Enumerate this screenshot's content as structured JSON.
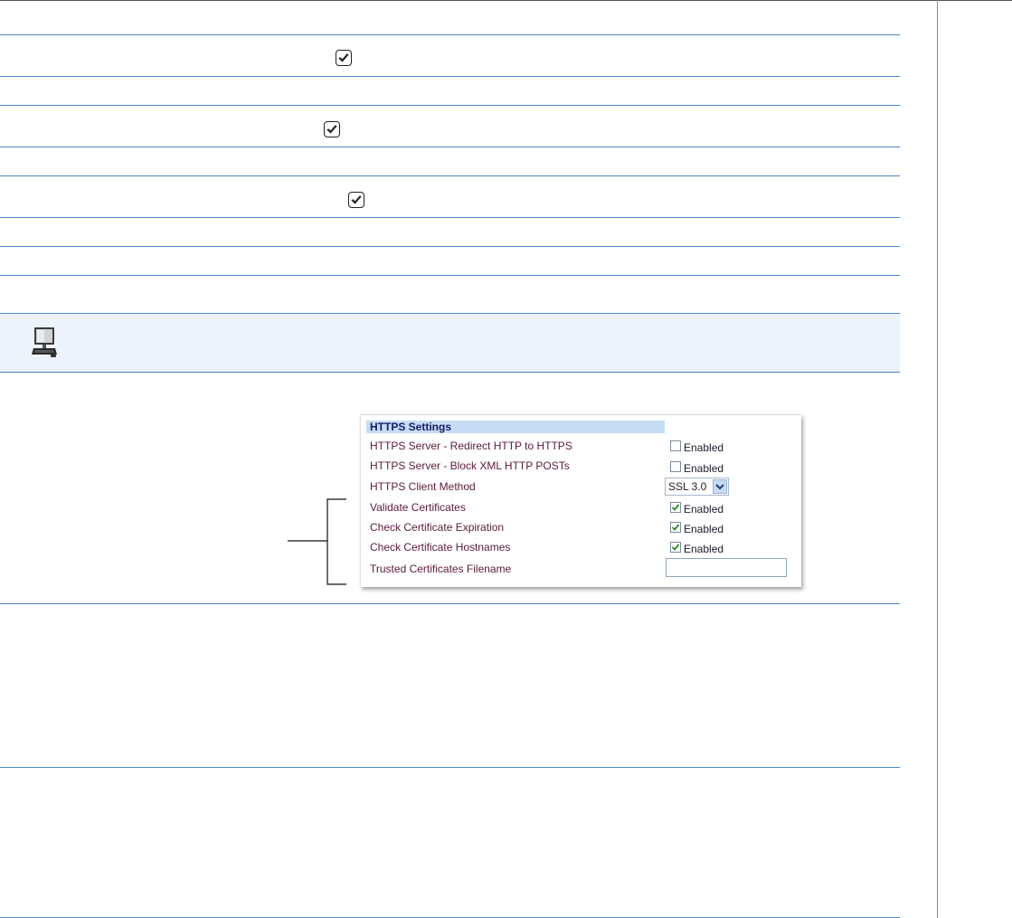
{
  "panel": {
    "header": "HTTPS Settings",
    "rows": [
      {
        "label": "HTTPS Server - Redirect HTTP to HTTPS",
        "control": "checkbox",
        "checked": false,
        "text": "Enabled"
      },
      {
        "label": "HTTPS Server - Block XML HTTP POSTs",
        "control": "checkbox",
        "checked": false,
        "text": "Enabled"
      },
      {
        "label": "HTTPS Client Method",
        "control": "select",
        "value": "SSL 3.0"
      },
      {
        "label": "Validate Certificates",
        "control": "checkbox",
        "checked": true,
        "text": "Enabled"
      },
      {
        "label": "Check Certificate Expiration",
        "control": "checkbox",
        "checked": true,
        "text": "Enabled"
      },
      {
        "label": "Check Certificate Hostnames",
        "control": "checkbox",
        "checked": true,
        "text": "Enabled"
      },
      {
        "label": "Trusted Certificates Filename",
        "control": "text",
        "value": ""
      }
    ]
  },
  "icons": {
    "doc_checks": "check-mark-icon",
    "note": "computer-icon"
  },
  "colors": {
    "rule": "#4a86c5",
    "note_band": "#edf3fa",
    "panel_header": "#c5dcf3",
    "check": "#2e8b2e"
  }
}
